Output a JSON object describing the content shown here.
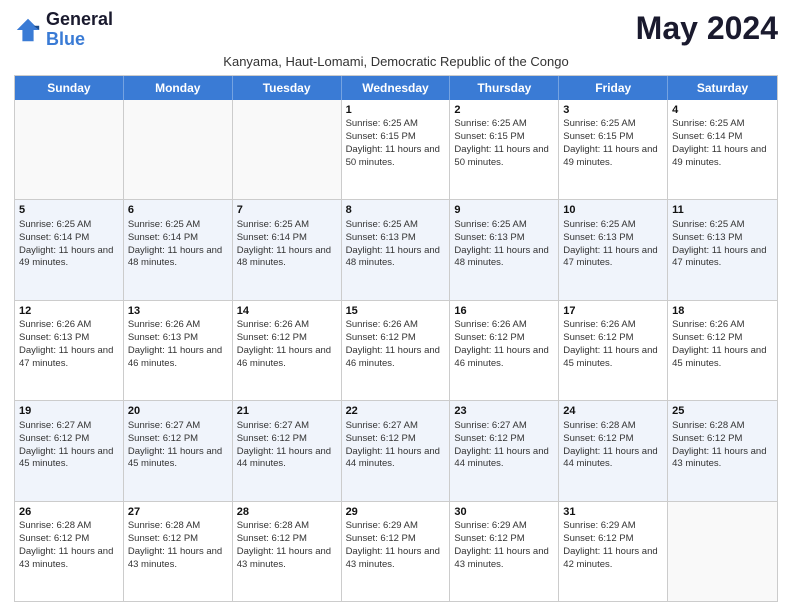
{
  "header": {
    "logo_line1": "General",
    "logo_line2": "Blue",
    "month_title": "May 2024",
    "subtitle": "Kanyama, Haut-Lomami, Democratic Republic of the Congo"
  },
  "days_of_week": [
    "Sunday",
    "Monday",
    "Tuesday",
    "Wednesday",
    "Thursday",
    "Friday",
    "Saturday"
  ],
  "weeks": [
    [
      {
        "day": "",
        "sunrise": "",
        "sunset": "",
        "daylight": ""
      },
      {
        "day": "",
        "sunrise": "",
        "sunset": "",
        "daylight": ""
      },
      {
        "day": "",
        "sunrise": "",
        "sunset": "",
        "daylight": ""
      },
      {
        "day": "1",
        "sunrise": "Sunrise: 6:25 AM",
        "sunset": "Sunset: 6:15 PM",
        "daylight": "Daylight: 11 hours and 50 minutes."
      },
      {
        "day": "2",
        "sunrise": "Sunrise: 6:25 AM",
        "sunset": "Sunset: 6:15 PM",
        "daylight": "Daylight: 11 hours and 50 minutes."
      },
      {
        "day": "3",
        "sunrise": "Sunrise: 6:25 AM",
        "sunset": "Sunset: 6:15 PM",
        "daylight": "Daylight: 11 hours and 49 minutes."
      },
      {
        "day": "4",
        "sunrise": "Sunrise: 6:25 AM",
        "sunset": "Sunset: 6:14 PM",
        "daylight": "Daylight: 11 hours and 49 minutes."
      }
    ],
    [
      {
        "day": "5",
        "sunrise": "Sunrise: 6:25 AM",
        "sunset": "Sunset: 6:14 PM",
        "daylight": "Daylight: 11 hours and 49 minutes."
      },
      {
        "day": "6",
        "sunrise": "Sunrise: 6:25 AM",
        "sunset": "Sunset: 6:14 PM",
        "daylight": "Daylight: 11 hours and 48 minutes."
      },
      {
        "day": "7",
        "sunrise": "Sunrise: 6:25 AM",
        "sunset": "Sunset: 6:14 PM",
        "daylight": "Daylight: 11 hours and 48 minutes."
      },
      {
        "day": "8",
        "sunrise": "Sunrise: 6:25 AM",
        "sunset": "Sunset: 6:13 PM",
        "daylight": "Daylight: 11 hours and 48 minutes."
      },
      {
        "day": "9",
        "sunrise": "Sunrise: 6:25 AM",
        "sunset": "Sunset: 6:13 PM",
        "daylight": "Daylight: 11 hours and 48 minutes."
      },
      {
        "day": "10",
        "sunrise": "Sunrise: 6:25 AM",
        "sunset": "Sunset: 6:13 PM",
        "daylight": "Daylight: 11 hours and 47 minutes."
      },
      {
        "day": "11",
        "sunrise": "Sunrise: 6:25 AM",
        "sunset": "Sunset: 6:13 PM",
        "daylight": "Daylight: 11 hours and 47 minutes."
      }
    ],
    [
      {
        "day": "12",
        "sunrise": "Sunrise: 6:26 AM",
        "sunset": "Sunset: 6:13 PM",
        "daylight": "Daylight: 11 hours and 47 minutes."
      },
      {
        "day": "13",
        "sunrise": "Sunrise: 6:26 AM",
        "sunset": "Sunset: 6:13 PM",
        "daylight": "Daylight: 11 hours and 46 minutes."
      },
      {
        "day": "14",
        "sunrise": "Sunrise: 6:26 AM",
        "sunset": "Sunset: 6:12 PM",
        "daylight": "Daylight: 11 hours and 46 minutes."
      },
      {
        "day": "15",
        "sunrise": "Sunrise: 6:26 AM",
        "sunset": "Sunset: 6:12 PM",
        "daylight": "Daylight: 11 hours and 46 minutes."
      },
      {
        "day": "16",
        "sunrise": "Sunrise: 6:26 AM",
        "sunset": "Sunset: 6:12 PM",
        "daylight": "Daylight: 11 hours and 46 minutes."
      },
      {
        "day": "17",
        "sunrise": "Sunrise: 6:26 AM",
        "sunset": "Sunset: 6:12 PM",
        "daylight": "Daylight: 11 hours and 45 minutes."
      },
      {
        "day": "18",
        "sunrise": "Sunrise: 6:26 AM",
        "sunset": "Sunset: 6:12 PM",
        "daylight": "Daylight: 11 hours and 45 minutes."
      }
    ],
    [
      {
        "day": "19",
        "sunrise": "Sunrise: 6:27 AM",
        "sunset": "Sunset: 6:12 PM",
        "daylight": "Daylight: 11 hours and 45 minutes."
      },
      {
        "day": "20",
        "sunrise": "Sunrise: 6:27 AM",
        "sunset": "Sunset: 6:12 PM",
        "daylight": "Daylight: 11 hours and 45 minutes."
      },
      {
        "day": "21",
        "sunrise": "Sunrise: 6:27 AM",
        "sunset": "Sunset: 6:12 PM",
        "daylight": "Daylight: 11 hours and 44 minutes."
      },
      {
        "day": "22",
        "sunrise": "Sunrise: 6:27 AM",
        "sunset": "Sunset: 6:12 PM",
        "daylight": "Daylight: 11 hours and 44 minutes."
      },
      {
        "day": "23",
        "sunrise": "Sunrise: 6:27 AM",
        "sunset": "Sunset: 6:12 PM",
        "daylight": "Daylight: 11 hours and 44 minutes."
      },
      {
        "day": "24",
        "sunrise": "Sunrise: 6:28 AM",
        "sunset": "Sunset: 6:12 PM",
        "daylight": "Daylight: 11 hours and 44 minutes."
      },
      {
        "day": "25",
        "sunrise": "Sunrise: 6:28 AM",
        "sunset": "Sunset: 6:12 PM",
        "daylight": "Daylight: 11 hours and 43 minutes."
      }
    ],
    [
      {
        "day": "26",
        "sunrise": "Sunrise: 6:28 AM",
        "sunset": "Sunset: 6:12 PM",
        "daylight": "Daylight: 11 hours and 43 minutes."
      },
      {
        "day": "27",
        "sunrise": "Sunrise: 6:28 AM",
        "sunset": "Sunset: 6:12 PM",
        "daylight": "Daylight: 11 hours and 43 minutes."
      },
      {
        "day": "28",
        "sunrise": "Sunrise: 6:28 AM",
        "sunset": "Sunset: 6:12 PM",
        "daylight": "Daylight: 11 hours and 43 minutes."
      },
      {
        "day": "29",
        "sunrise": "Sunrise: 6:29 AM",
        "sunset": "Sunset: 6:12 PM",
        "daylight": "Daylight: 11 hours and 43 minutes."
      },
      {
        "day": "30",
        "sunrise": "Sunrise: 6:29 AM",
        "sunset": "Sunset: 6:12 PM",
        "daylight": "Daylight: 11 hours and 43 minutes."
      },
      {
        "day": "31",
        "sunrise": "Sunrise: 6:29 AM",
        "sunset": "Sunset: 6:12 PM",
        "daylight": "Daylight: 11 hours and 42 minutes."
      },
      {
        "day": "",
        "sunrise": "",
        "sunset": "",
        "daylight": ""
      }
    ]
  ]
}
